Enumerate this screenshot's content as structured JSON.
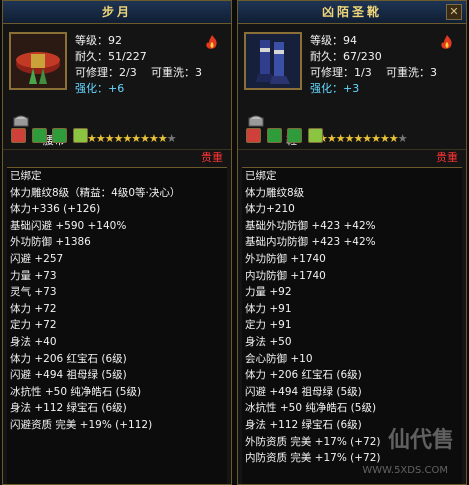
{
  "panels": [
    {
      "title": "步月",
      "stats": {
        "level": "等级：92",
        "durability": "耐久：51/227",
        "repairable": "可修理：2/3",
        "rewashable": "可重洗：3",
        "enhance": "强化：+6"
      },
      "name": "腰带",
      "stars": "★★★★★★★★★",
      "gems": [
        "#d0403a",
        "#2e9c3b",
        "#2e9c3b",
        "#8ac440"
      ],
      "tag": "贵重",
      "attributes": [
        {
          "text": "已绑定",
          "color": "white"
        },
        {
          "text": "体力雕纹8级（精益：4级0等·决心）",
          "color": "red"
        },
        {
          "text": "体力+336 (+126)",
          "color": "red"
        },
        {
          "text": "基础闪避 +590 +140%",
          "color": "white"
        },
        {
          "text": "外功防御 +1386",
          "color": "white"
        },
        {
          "text": "闪避 +257",
          "color": "white"
        },
        {
          "text": "力量 +73",
          "color": "white"
        },
        {
          "text": "灵气 +73",
          "color": "white"
        },
        {
          "text": "体力 +72",
          "color": "white"
        },
        {
          "text": "定力 +72",
          "color": "white"
        },
        {
          "text": "身法 +40",
          "color": "white"
        },
        {
          "text": "体力 +206 红宝石 (6级)",
          "color": "white"
        },
        {
          "text": "闪避 +494 祖母绿 (5级)",
          "color": "white"
        },
        {
          "text": "冰抗性 +50 纯净皓石 (5级)",
          "color": "white"
        },
        {
          "text": "身法 +112 绿宝石 (6级)",
          "color": "white"
        },
        {
          "text": "闪避资质  完美 +19% (+112)",
          "color": "red"
        }
      ]
    },
    {
      "title": "凶陌圣靴",
      "stats": {
        "level": "等级：94",
        "durability": "耐久：67/230",
        "repairable": "可修理：1/3",
        "rewashable": "可重洗：3",
        "enhance": "强化：+3"
      },
      "name": "鞋",
      "stars": "★★★★★★★★★",
      "gems": [
        "#d0403a",
        "#2e9c3b",
        "#2e9c3b",
        "#8ac440"
      ],
      "tag": "贵重",
      "attributes": [
        {
          "text": "已绑定",
          "color": "white"
        },
        {
          "text": "体力雕纹8级",
          "color": "red"
        },
        {
          "text": "体力+210",
          "color": "red"
        },
        {
          "text": "基础外功防御 +423 +42%",
          "color": "white"
        },
        {
          "text": "基础内功防御 +423 +42%",
          "color": "white"
        },
        {
          "text": "外功防御 +1740",
          "color": "white"
        },
        {
          "text": "内功防御 +1740",
          "color": "white"
        },
        {
          "text": "力量 +92",
          "color": "white"
        },
        {
          "text": "体力 +91",
          "color": "white"
        },
        {
          "text": "定力 +91",
          "color": "white"
        },
        {
          "text": "身法 +50",
          "color": "white"
        },
        {
          "text": "会心防御 +10",
          "color": "white"
        },
        {
          "text": "体力 +206 红宝石 (6级)",
          "color": "white"
        },
        {
          "text": "闪避 +494 祖母绿 (5级)",
          "color": "white"
        },
        {
          "text": "冰抗性 +50 纯净皓石 (5级)",
          "color": "white"
        },
        {
          "text": "身法 +112 绿宝石 (6级)",
          "color": "white"
        },
        {
          "text": "外防资质  完美 +17% (+72)",
          "color": "red"
        },
        {
          "text": "内防资质  完美 +17% (+72)",
          "color": "red"
        }
      ]
    }
  ],
  "close_label": "✕",
  "watermark": {
    "text": "仙代售",
    "url": "WWW.5XDS.COM"
  }
}
